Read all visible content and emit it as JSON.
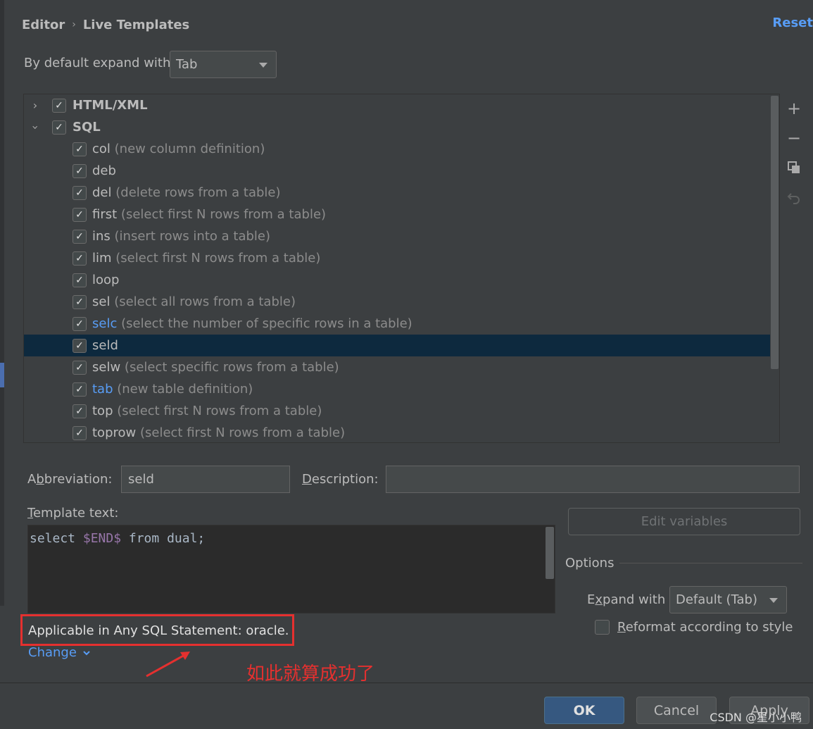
{
  "breadcrumb": {
    "parent": "Editor",
    "separator": "›",
    "current": "Live Templates"
  },
  "reset_label": "Reset",
  "expand_default": {
    "label": "By default expand with",
    "value": "Tab"
  },
  "tree": {
    "groups": [
      {
        "name": "HTML/XML",
        "checked": true,
        "expanded": false
      },
      {
        "name": "SQL",
        "checked": true,
        "expanded": true
      }
    ],
    "items": [
      {
        "abbr": "col",
        "desc": "(new column definition)",
        "checked": true
      },
      {
        "abbr": "deb",
        "desc": "",
        "checked": true
      },
      {
        "abbr": "del",
        "desc": "(delete rows from a table)",
        "checked": true
      },
      {
        "abbr": "first",
        "desc": "(select first N rows from a table)",
        "checked": true
      },
      {
        "abbr": "ins",
        "desc": "(insert rows into a table)",
        "checked": true
      },
      {
        "abbr": "lim",
        "desc": "(select first N rows from a table)",
        "checked": true
      },
      {
        "abbr": "loop",
        "desc": "",
        "checked": true
      },
      {
        "abbr": "sel",
        "desc": "(select all rows from a table)",
        "checked": true
      },
      {
        "abbr": "selc",
        "desc": "(select the number of specific rows in a table)",
        "checked": true,
        "modified": true
      },
      {
        "abbr": "seld",
        "desc": "",
        "checked": true,
        "selected": true
      },
      {
        "abbr": "selw",
        "desc": "(select specific rows from a table)",
        "checked": true
      },
      {
        "abbr": "tab",
        "desc": "(new table definition)",
        "checked": true,
        "modified": true
      },
      {
        "abbr": "top",
        "desc": "(select first N rows from a table)",
        "checked": true
      },
      {
        "abbr": "toprow",
        "desc": "(select first N rows from a table)",
        "checked": true
      }
    ]
  },
  "toolbar_icons": [
    "add-icon",
    "remove-icon",
    "copy-icon",
    "restore-icon"
  ],
  "form": {
    "abbreviation_label_pre": "A",
    "abbreviation_label_mnemonic": "b",
    "abbreviation_label_post": "breviation:",
    "abbreviation_value": "seld",
    "description_label_mnemonic": "D",
    "description_label_post": "escription:",
    "description_value": "",
    "template_label_mnemonic": "T",
    "template_label_post": "emplate text:",
    "template_text": {
      "before": "select ",
      "variable": "$END$",
      "after": " from dual;"
    },
    "edit_variables_label": "Edit variables"
  },
  "options": {
    "title": "Options",
    "expand_with_pre": "E",
    "expand_with_mnemonic": "x",
    "expand_with_post": "pand with",
    "expand_with_value": "Default (Tab)",
    "reformat_mnemonic": "R",
    "reformat_post": "eformat according to style",
    "reformat_checked": false
  },
  "context": {
    "applicable_text": "Applicable in Any SQL Statement: oracle.",
    "change_label": "Change"
  },
  "annotation_text": "如此就算成功了",
  "buttons": {
    "ok": "OK",
    "cancel": "Cancel",
    "apply": "Apply"
  },
  "watermark": "CSDN @星小小鸭",
  "colors": {
    "accent": "#589df6",
    "selection": "#0d293e",
    "annotation": "#e5302f"
  }
}
